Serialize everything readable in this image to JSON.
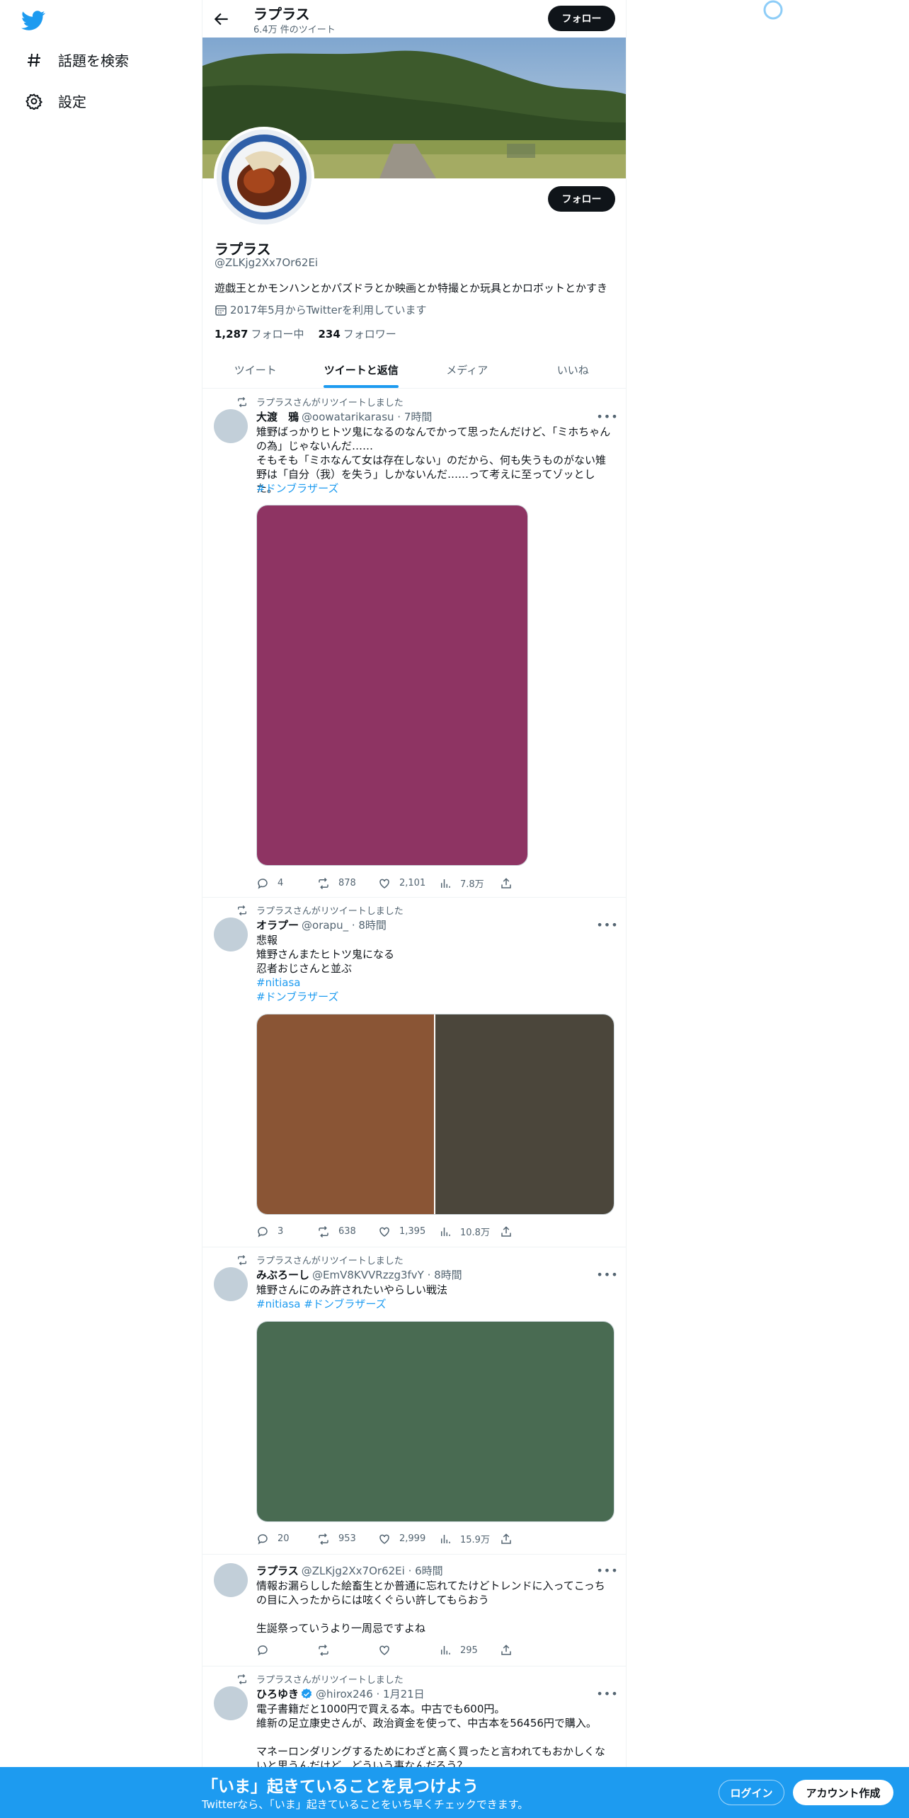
{
  "sidebar": {
    "explore_label": "話題を検索",
    "settings_label": "設定"
  },
  "header": {
    "title": "ラプラス",
    "tweet_count": "6.4万 件のツイート",
    "follow_label": "フォロー"
  },
  "profile": {
    "name": "ラプラス",
    "handle": "@ZLKjg2Xx7Or62Ei",
    "bio": "遊戯王とかモンハンとかパズドラとか映画とか特撮とか玩具とかロボットとかすき",
    "joined": "2017年5月からTwitterを利用しています",
    "following_count": "1,287",
    "following_label": "フォロー中",
    "followers_count": "234",
    "followers_label": "フォロワー",
    "follow_label": "フォロー"
  },
  "tabs": [
    {
      "label": "ツイート"
    },
    {
      "label": "ツイートと返信"
    },
    {
      "label": "メディア"
    },
    {
      "label": "いいね"
    }
  ],
  "tweets": [
    {
      "retweet_label": "ラプラスさんがリツイートしました",
      "name": "大渡　鴉",
      "handle": "@oowatarikarasu · 7時間",
      "text": "雉野ばっかりヒトツ鬼になるのなんでかって思ったんだけど、「ミホちゃんの為」じゃないんだ……\nそもそも「ミホなんて女は存在しない」のだから、何も失うものがない雉野は「自分（我）を失う」しかないんだ……って考えに至ってゾッとした。",
      "hashtags": "#ドンブラザーズ",
      "media_color": "#8e3463",
      "replies": "4",
      "retweets": "878",
      "likes": "2,101",
      "views": "7.8万"
    },
    {
      "retweet_label": "ラプラスさんがリツイートしました",
      "name": "オラプー",
      "handle": "@orapu_ · 8時間",
      "text": "悲報\n雉野さんまたヒトツ鬼になる\n忍者おじさんと並ぶ",
      "hashtags": "#nitiasa",
      "hashtags2": "#ドンブラザーズ",
      "media_color": "#8a5535",
      "media_color2": "#4b463b",
      "replies": "3",
      "retweets": "638",
      "likes": "1,395",
      "views": "10.8万"
    },
    {
      "retweet_label": "ラプラスさんがリツイートしました",
      "name": "みぶろーし",
      "handle": "@EmV8KVVRzzg3fvY · 8時間",
      "text": "雉野さんにのみ許されたいやらしい戦法",
      "hashtags": "#nitiasa #ドンブラザーズ",
      "media_color": "#496b52",
      "replies": "20",
      "retweets": "953",
      "likes": "2,999",
      "views": "15.9万"
    },
    {
      "name": "ラプラス",
      "handle": "@ZLKjg2Xx7Or62Ei · 6時間",
      "text": "情報お漏らしした絵畜生とか普通に忘れてたけどトレンドに入ってこっちの目に入ったからには呟くぐらい許してもらおう\n\n生誕祭っていうより一周忌ですよね",
      "views": "295"
    },
    {
      "retweet_label": "ラプラスさんがリツイートしました",
      "name": "ひろゆき",
      "handle": "@hirox246 · 1月21日",
      "text": "電子書籍だと1000円で買える本。中古でも600円。\n維新の足立康史さんが、政治資金を使って、中古本を56456円で購入。\n\nマネーロンダリングするためにわざと高く買ったと言われてもおかしくないと思うんだけど、どういう事なんだろう？"
    }
  ],
  "bottom_bar": {
    "title": "「いま」起きていることを見つけよう",
    "subtitle": "Twitterなら、「いま」起きていることをいち早くチェックできます。",
    "login_label": "ログイン",
    "signup_label": "アカウント作成"
  },
  "colors": {
    "accent": "#1d9bf0",
    "text": "#0f1419",
    "muted": "#536471"
  }
}
